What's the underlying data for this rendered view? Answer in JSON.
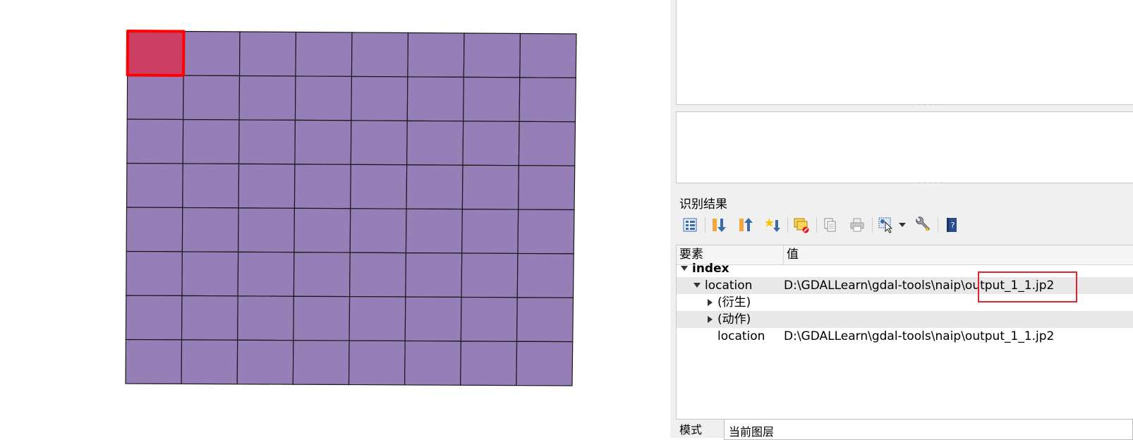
{
  "map": {
    "grid_rows": 8,
    "grid_cols": 8,
    "cell_fill": "#967eb7",
    "cell_stroke": "#1a1a1a",
    "selected_cell": {
      "row": 0,
      "col": 0
    },
    "selected_fill": "#cc3e61",
    "selected_stroke": "#ff0000"
  },
  "identify_panel": {
    "title": "识别结果",
    "toolbar": [
      {
        "name": "expand-tree-icon"
      },
      {
        "name": "expand-all-icon"
      },
      {
        "name": "collapse-all-icon"
      },
      {
        "name": "expand-new-results-icon"
      },
      {
        "name": "clear-results-icon"
      },
      {
        "name": "copy-feature-icon"
      },
      {
        "name": "print-icon"
      },
      {
        "name": "identify-mode-icon"
      },
      {
        "name": "settings-wrench-icon"
      },
      {
        "name": "help-icon"
      }
    ],
    "columns": {
      "feature": "要素",
      "value": "值"
    },
    "rows": [
      {
        "label": "index",
        "value": ""
      },
      {
        "label": "location",
        "value": "D:\\GDALLearn\\gdal-tools\\naip\\output_1_1.jp2"
      },
      {
        "label": "(衍生)",
        "value": ""
      },
      {
        "label": "(动作)",
        "value": ""
      },
      {
        "label": "location",
        "value": "D:\\GDALLearn\\gdal-tools\\naip\\output_1_1.jp2"
      }
    ],
    "mode_label": "模式",
    "mode_value": "当前图层",
    "accent_color": "#e5222e"
  }
}
